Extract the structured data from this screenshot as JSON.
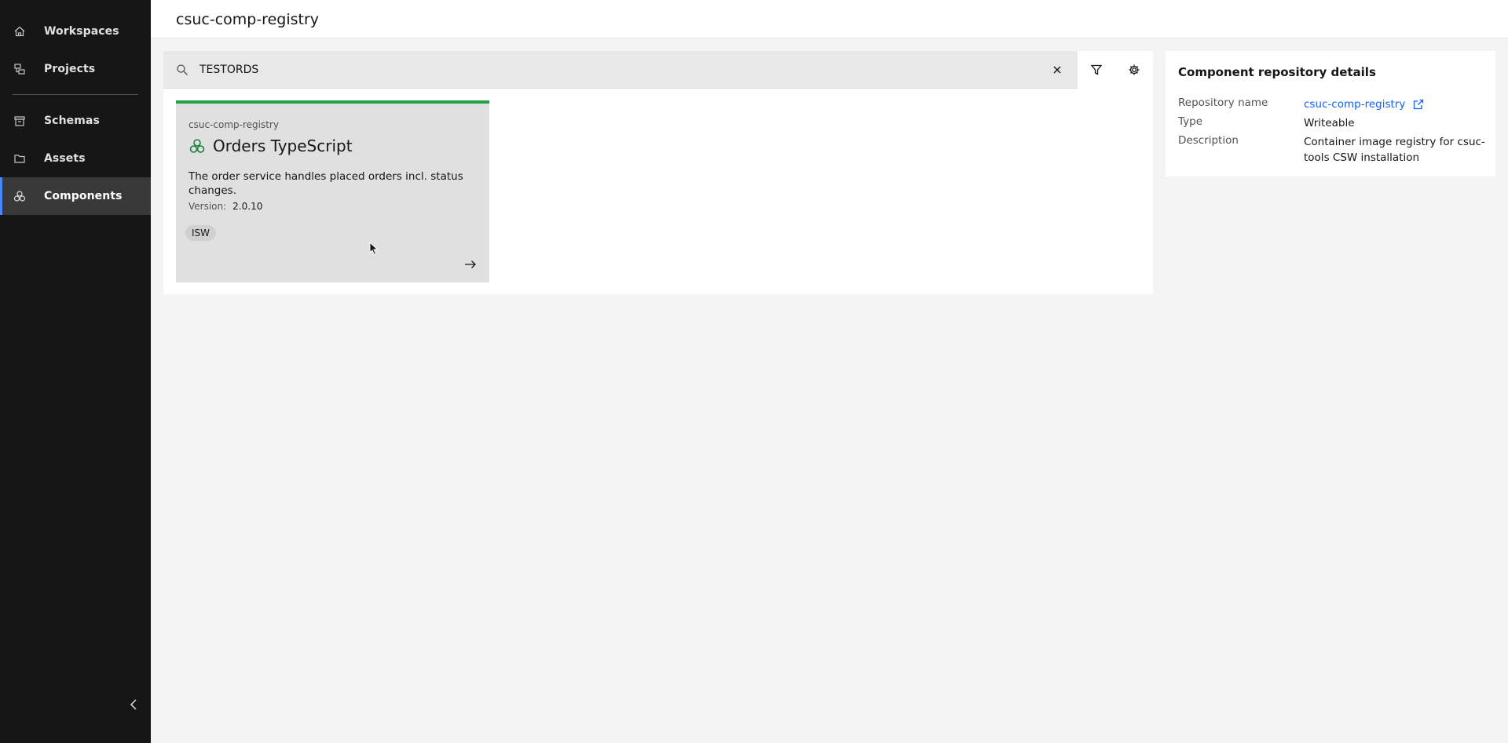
{
  "sidebar": {
    "items": [
      {
        "label": "Workspaces",
        "icon": "home-icon"
      },
      {
        "label": "Projects",
        "icon": "projects-icon"
      },
      {
        "label": "Schemas",
        "icon": "schemas-icon"
      },
      {
        "label": "Assets",
        "icon": "folder-icon"
      },
      {
        "label": "Components",
        "icon": "components-icon",
        "active": true
      }
    ]
  },
  "header": {
    "title": "csuc-comp-registry"
  },
  "search": {
    "value": "TESTORDS",
    "placeholder": "Search"
  },
  "tile": {
    "repository": "csuc-comp-registry",
    "title": "Orders TypeScript",
    "description": "The order service handles placed orders incl. status changes.",
    "version_label": "Version:",
    "version": "2.0.10",
    "tag": "ISW"
  },
  "details": {
    "title": "Component repository details",
    "rows": [
      {
        "key": "Repository name",
        "value": "csuc-comp-registry"
      },
      {
        "key": "Type",
        "value": "Writeable"
      },
      {
        "key": "Description",
        "value": "Container image registry for csuc-tools CSW installation"
      }
    ]
  },
  "colors": {
    "sidebar_bg": "#161616",
    "accent": "#4589ff",
    "tile_border": "#24a148",
    "link": "#0f62fe"
  }
}
